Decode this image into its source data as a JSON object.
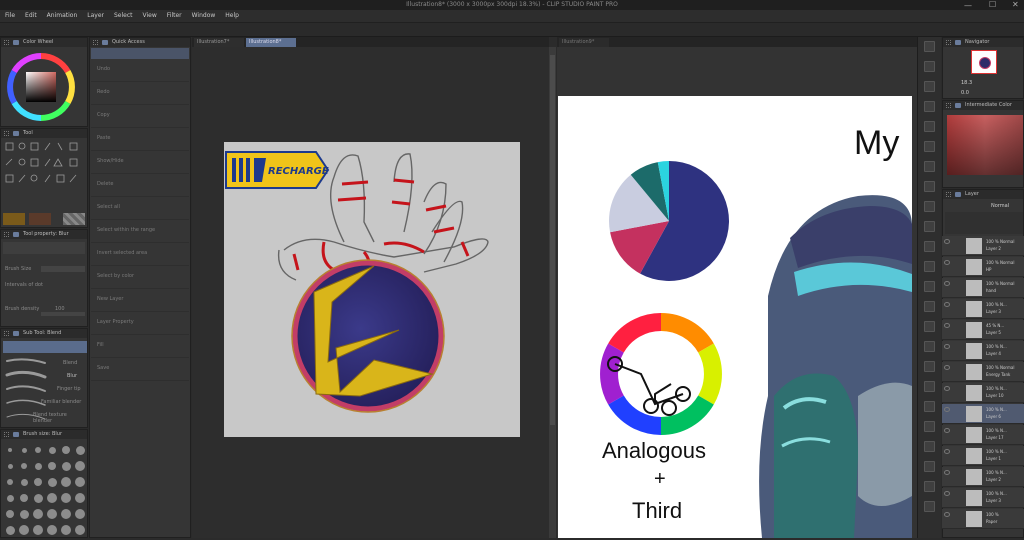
{
  "app": {
    "title": "Illustration8* (3000 x 3000px 300dpi 18.3%)  - CLIP STUDIO PAINT PRO"
  },
  "menu": [
    "File",
    "Edit",
    "Animation",
    "Layer",
    "Select",
    "View",
    "Filter",
    "Window",
    "Help"
  ],
  "left_panels": {
    "color_wheel": "Color Wheel",
    "tool": "Tool",
    "tool_property": "Tool property: Blur",
    "brush_size_label": "Brush Size",
    "intervals_label": "Intervals of dot",
    "brush_density_label": "Brush density",
    "brush_density_value": "100",
    "sub_tool": "Sub Tool: Blend",
    "sub_tools": [
      "Blend",
      "Blur",
      "Finger tip",
      "Familiar blender",
      "Blend texture blender"
    ],
    "brush_size_panel": "Brush size: Blur"
  },
  "quick_access": {
    "title": "Quick Access",
    "items": [
      "Quick Access",
      "Undo",
      "Redo",
      "Copy",
      "Paste",
      "Show/Hide",
      "Delete",
      "Select all",
      "Select within the range",
      "Invert selected area",
      "Select by color",
      "New Layer",
      "Layer Property",
      "Fill",
      "Save"
    ]
  },
  "tabs": {
    "left_canvas": [
      "Illustration7*",
      "Illustration8*"
    ],
    "right_canvas": "Illustration9*"
  },
  "artwork": {
    "recharge_logo": "RECHARGE",
    "title_text": "My",
    "analogous_line1": "Analogous",
    "analogous_line2": "+",
    "analogous_line3": "Third"
  },
  "right_panels": {
    "navigator": "Navigator",
    "zoom_value": "18.3",
    "rotate_value": "0.0",
    "intermediate_color": "Intermediate Color",
    "layer": "Layer",
    "blend_mode": "Normal"
  },
  "layers": [
    {
      "name": "100 % Normal",
      "sub": "Layer 2"
    },
    {
      "name": "100 % Normal",
      "sub": "HP"
    },
    {
      "name": "100 % Normal",
      "sub": "hand"
    },
    {
      "name": "100 % N...",
      "sub": "Layer 3"
    },
    {
      "name": "45 % N...",
      "sub": "Layer 5"
    },
    {
      "name": "100 % N...",
      "sub": "Layer 4"
    },
    {
      "name": "100 % Normal",
      "sub": "Energy Tank"
    },
    {
      "name": "100 % N...",
      "sub": "Layer 10"
    },
    {
      "name": "100 % N...",
      "sub": "Layer 6"
    },
    {
      "name": "100 % N...",
      "sub": "Layer 17"
    },
    {
      "name": "100 % N...",
      "sub": "Layer 1"
    },
    {
      "name": "100 % N...",
      "sub": "Layer 2"
    },
    {
      "name": "100 % N...",
      "sub": "Layer 3"
    },
    {
      "name": "100 %",
      "sub": "Paper"
    }
  ],
  "pie": {
    "values": [
      58,
      14,
      17,
      8,
      3
    ],
    "colors": [
      "#2e3280",
      "#c4315f",
      "#c9cde0",
      "#1c6b6a",
      "#2bd4e0"
    ]
  }
}
